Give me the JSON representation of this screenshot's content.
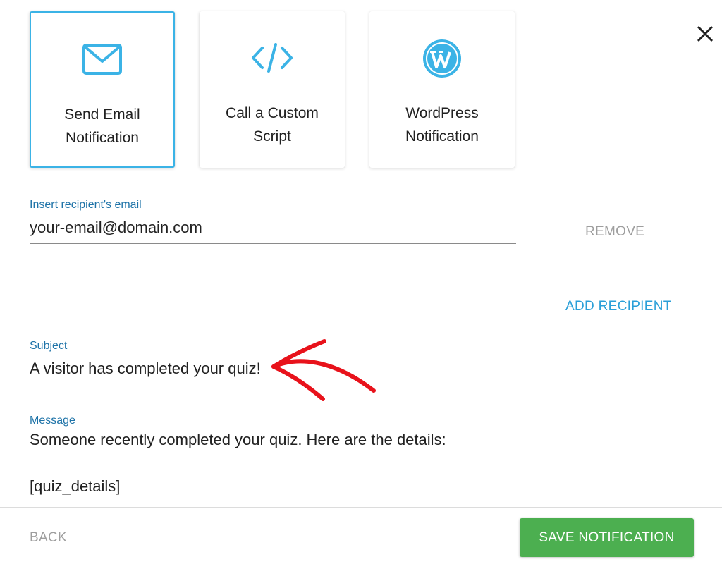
{
  "action_cards": [
    {
      "label": "Send Email\nNotification",
      "icon": "envelope-icon",
      "selected": true
    },
    {
      "label": "Call a Custom\nScript",
      "icon": "code-icon",
      "selected": false
    },
    {
      "label": "WordPress\nNotification",
      "icon": "wordpress-icon",
      "selected": false
    }
  ],
  "recipient": {
    "label": "Insert recipient's email",
    "value": "your-email@domain.com",
    "remove_label": "REMOVE"
  },
  "add_recipient_label": "ADD RECIPIENT",
  "subject": {
    "label": "Subject",
    "value": "A visitor has completed your quiz!"
  },
  "message": {
    "label": "Message",
    "line1": "Someone recently completed your quiz. Here are the details:",
    "line2": "[quiz_details]"
  },
  "footer": {
    "back_label": "BACK",
    "save_label": "SAVE NOTIFICATION"
  },
  "colors": {
    "accent": "#3bb3e6",
    "field_label": "#1e73a8",
    "add_recipient": "#2a9fd8",
    "muted": "#9e9e9e",
    "save_button": "#4caf50",
    "annotation_arrow": "#e8121b"
  }
}
